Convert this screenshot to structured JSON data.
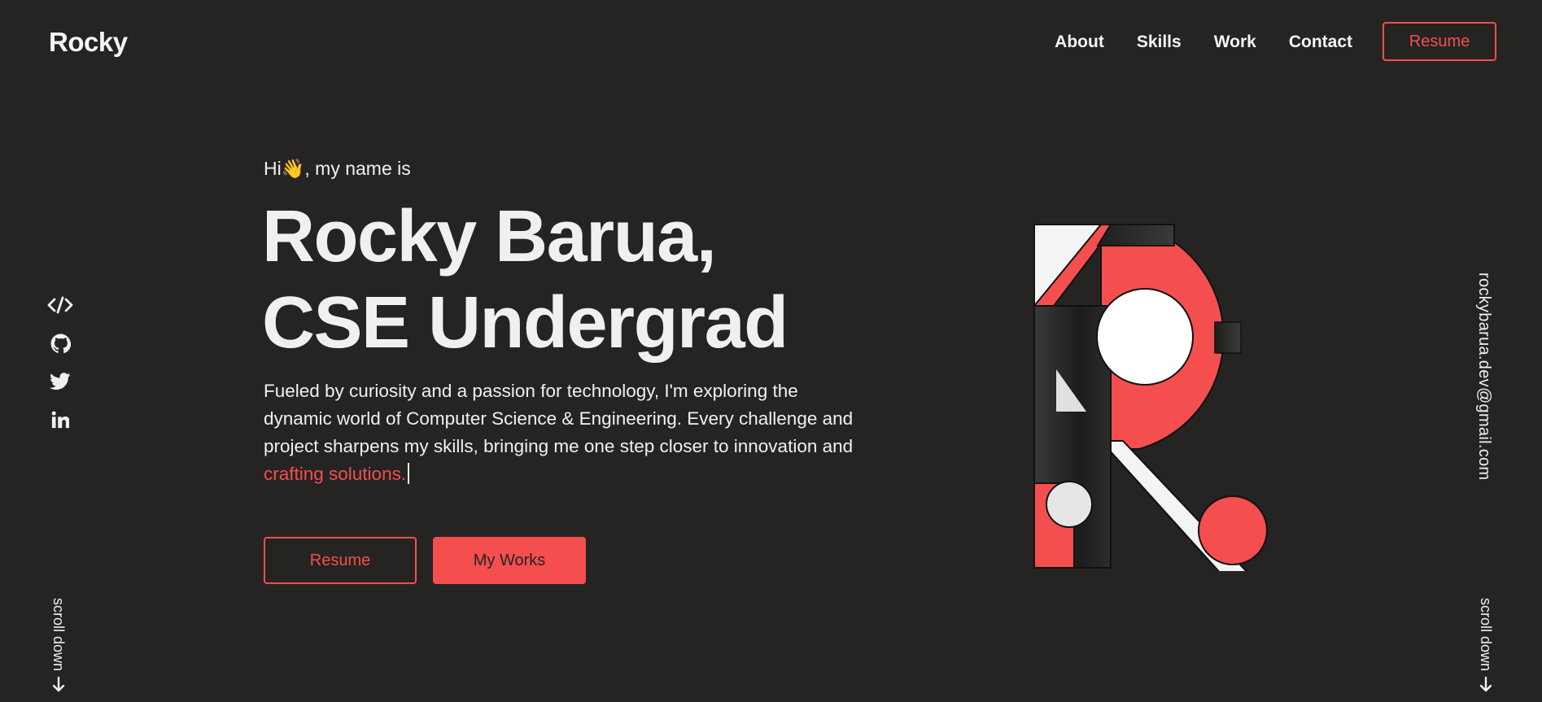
{
  "header": {
    "logo": "Rocky",
    "nav": [
      "About",
      "Skills",
      "Work",
      "Contact"
    ],
    "resume_label": "Resume"
  },
  "hero": {
    "greeting_prefix": "Hi",
    "greeting_emoji": "👋",
    "greeting_suffix": ", my name is",
    "title_line1": "Rocky Barua,",
    "title_line2": "CSE Undergrad",
    "description": "Fueled by curiosity and a passion for technology, I'm exploring the dynamic world of Computer Science & Engineering. Every challenge and project sharpens my skills, bringing me one step closer to innovation and ",
    "description_highlight": "crafting solutions.",
    "resume_button": "Resume",
    "works_button": "My Works"
  },
  "socials": [
    "code-icon",
    "github-icon",
    "twitter-icon",
    "linkedin-icon"
  ],
  "email": "rockybarua.dev@gmail.com",
  "scroll_label": "scroll down",
  "colors": {
    "background": "#252423",
    "accent": "#f44e4e",
    "text": "#f0f0f0"
  }
}
